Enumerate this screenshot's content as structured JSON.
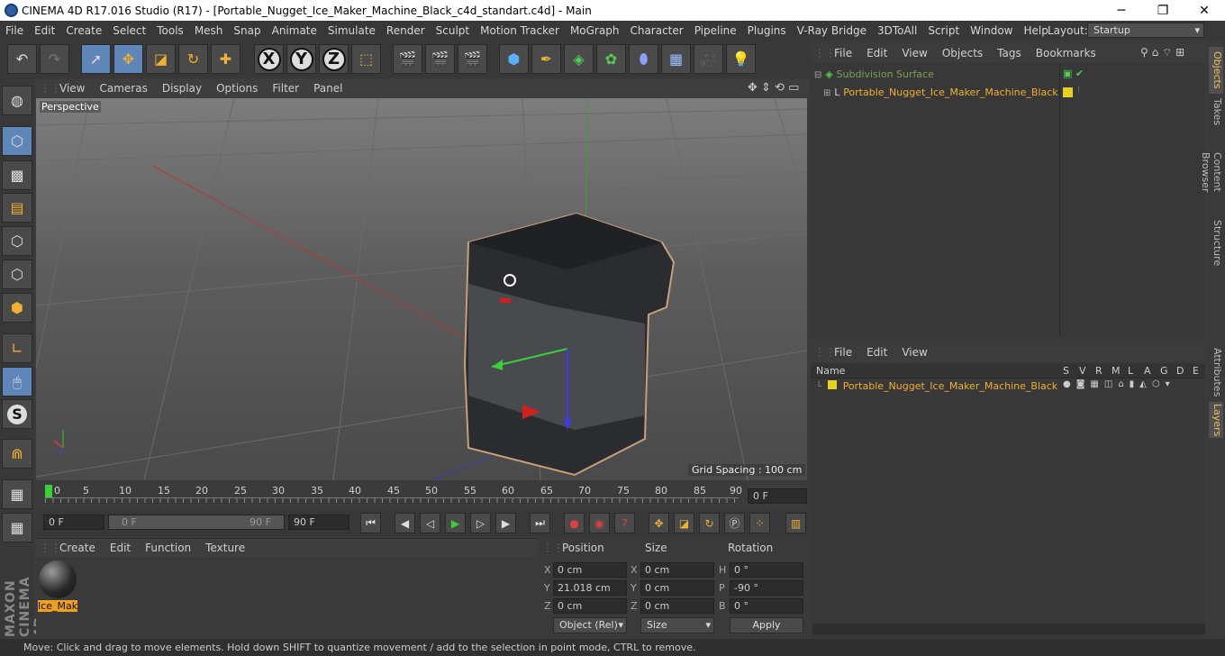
{
  "window": {
    "title": "CINEMA 4D R17.016 Studio (R17) - [Portable_Nugget_Ice_Maker_Machine_Black_c4d_standart.c4d] - Main",
    "minimize": "─",
    "maximize": "❐",
    "close": "✕"
  },
  "menu": [
    "File",
    "Edit",
    "Create",
    "Select",
    "Tools",
    "Mesh",
    "Snap",
    "Animate",
    "Simulate",
    "Render",
    "Sculpt",
    "Motion Tracker",
    "MoGraph",
    "Character",
    "Pipeline",
    "Plugins",
    "V-Ray Bridge",
    "3DToAll",
    "Script",
    "Window",
    "Help"
  ],
  "layout": {
    "label": "Layout:",
    "value": "Startup"
  },
  "viewport": {
    "menu": [
      "View",
      "Cameras",
      "Display",
      "Options",
      "Filter",
      "Panel"
    ],
    "name": "Perspective",
    "grid_spacing": "Grid Spacing : 100 cm"
  },
  "timeline": {
    "ticks": [
      "0",
      "5",
      "10",
      "15",
      "20",
      "25",
      "30",
      "35",
      "40",
      "45",
      "50",
      "55",
      "60",
      "65",
      "70",
      "75",
      "80",
      "85",
      "90"
    ],
    "current_frame": "0 F"
  },
  "timectl": {
    "start": "0 F",
    "range_start": "0 F",
    "range_end": "90 F",
    "end": "90 F"
  },
  "material": {
    "menu": [
      "Create",
      "Edit",
      "Function",
      "Texture"
    ],
    "name": "Ice_Mak"
  },
  "coords": {
    "headers": {
      "position": "Position",
      "size": "Size",
      "rotation": "Rotation"
    },
    "labels": {
      "x": "X",
      "y": "Y",
      "z": "Z",
      "h": "H",
      "p": "P",
      "b": "B"
    },
    "position": {
      "x": "0 cm",
      "y": "21.018 cm",
      "z": "0 cm"
    },
    "size": {
      "x": "0 cm",
      "y": "0 cm",
      "z": "0 cm"
    },
    "rotation": {
      "h": "0 °",
      "p": "-90 °",
      "b": "0 °"
    },
    "mode": "Object (Rel)",
    "size_mode": "Size",
    "apply": "Apply"
  },
  "objects": {
    "menu": [
      "File",
      "Edit",
      "View",
      "Objects",
      "Tags",
      "Bookmarks"
    ],
    "items": [
      "Subdivision Surface",
      "Portable_Nugget_Ice_Maker_Machine_Black"
    ]
  },
  "layers": {
    "menu": [
      "File",
      "Edit",
      "View"
    ],
    "name_header": "Name",
    "col_headers": [
      "S",
      "V",
      "R",
      "M",
      "L",
      "A",
      "G",
      "D",
      "E"
    ],
    "item": "Portable_Nugget_Ice_Maker_Machine_Black"
  },
  "sidetabs": [
    "Objects",
    "Takes",
    "Content Browser",
    "Structure",
    "Attributes",
    "Layers"
  ],
  "status": "Move: Click and drag to move elements. Hold down SHIFT to quantize movement / add to the selection in point mode, CTRL to remove.",
  "colors": {
    "accent": "#5f86b8",
    "highlight": "#f0b030",
    "layer_color": "#e8d020"
  }
}
